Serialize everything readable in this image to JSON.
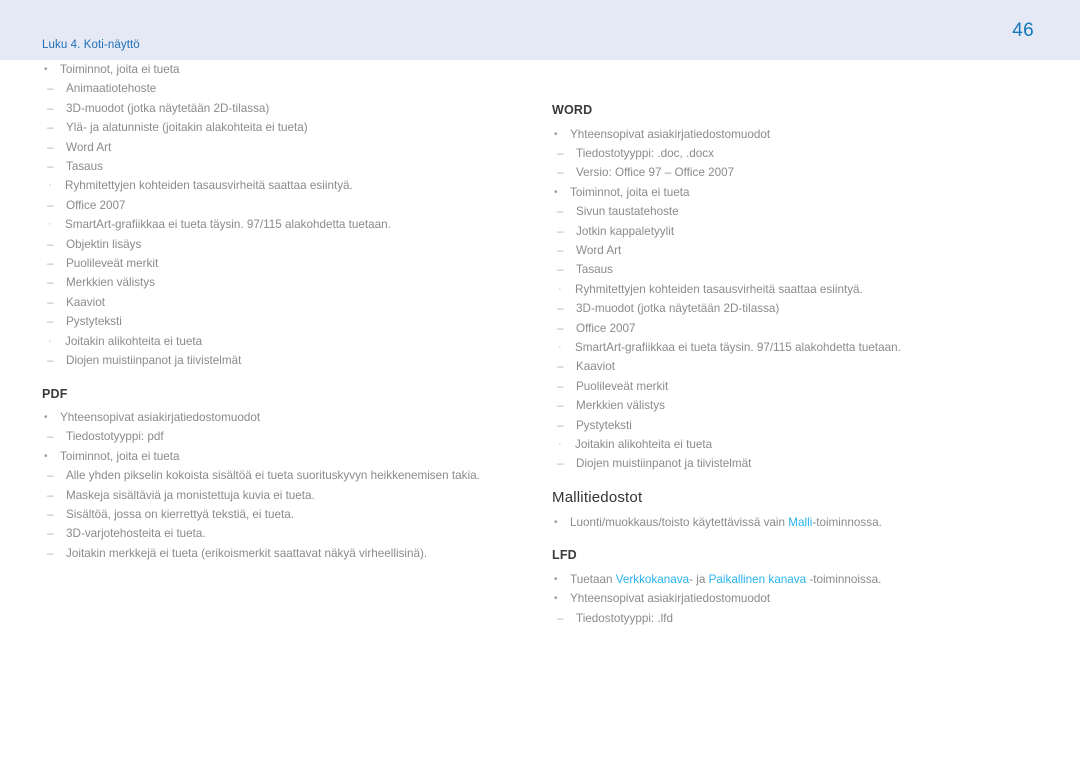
{
  "header": {
    "chapter": "Luku 4. Koti-näyttö",
    "page_number": "46",
    "band_color": "#e4e9f5",
    "chapter_color": "#1f6fb5",
    "page_number_color": "#1478bd"
  },
  "theme": {
    "body_text_color": "#8b8b8b",
    "heading_color": "#3a3a3a",
    "highlight_color": "#29b3ee",
    "background": "#ffffff"
  },
  "markers": {
    "level1": "•",
    "level2": "–",
    "level3": "·"
  },
  "left_column": {
    "intro_list": {
      "item": "Toiminnot, joita ei tueta",
      "subitems": [
        {
          "text": "Animaatiotehoste"
        },
        {
          "text": "3D-muodot (jotka näytetään 2D-tilassa)"
        },
        {
          "text": "Ylä- ja alatunniste (joitakin alakohteita ei tueta)"
        },
        {
          "text": "Word Art"
        },
        {
          "text": "Tasaus",
          "sub": [
            "Ryhmitettyjen kohteiden tasausvirheitä saattaa esiintyä."
          ]
        },
        {
          "text": "Office 2007",
          "sub": [
            "SmartArt-grafiikkaa ei tueta täysin. 97/115 alakohdetta tuetaan."
          ]
        },
        {
          "text": "Objektin lisäys"
        },
        {
          "text": "Puolileveät merkit"
        },
        {
          "text": "Merkkien välistys"
        },
        {
          "text": "Kaaviot"
        },
        {
          "text": "Pystyteksti",
          "sub": [
            "Joitakin alikohteita ei tueta"
          ]
        },
        {
          "text": "Diojen muistiinpanot ja tiivistelmät"
        }
      ]
    },
    "pdf_section": {
      "heading": "PDF",
      "items": [
        {
          "text": "Yhteensopivat asiakirjatiedostomuodot",
          "subitems": [
            {
              "text": "Tiedostotyyppi: pdf"
            }
          ]
        },
        {
          "text": "Toiminnot, joita ei tueta",
          "subitems": [
            {
              "text": "Alle yhden pikselin kokoista sisältöä ei tueta suorituskyvyn heikkenemisen takia."
            },
            {
              "text": "Maskeja sisältäviä ja monistettuja kuvia ei tueta."
            },
            {
              "text": "Sisältöä, jossa on kierrettyä tekstiä, ei tueta."
            },
            {
              "text": "3D-varjotehosteita ei tueta."
            },
            {
              "text": "Joitakin merkkejä ei tueta (erikoismerkit saattavat näkyä virheellisinä)."
            }
          ]
        }
      ]
    }
  },
  "right_column": {
    "word_section": {
      "heading": "WORD",
      "items": [
        {
          "text": "Yhteensopivat asiakirjatiedostomuodot",
          "subitems": [
            {
              "text": "Tiedostotyyppi: .doc, .docx"
            },
            {
              "text": "Versio: Office 97 – Office 2007"
            }
          ]
        },
        {
          "text": "Toiminnot, joita ei tueta",
          "subitems": [
            {
              "text": "Sivun taustatehoste"
            },
            {
              "text": "Jotkin kappaletyylit"
            },
            {
              "text": "Word Art"
            },
            {
              "text": "Tasaus",
              "sub": [
                "Ryhmitettyjen kohteiden tasausvirheitä saattaa esiintyä."
              ]
            },
            {
              "text": "3D-muodot (jotka näytetään 2D-tilassa)"
            },
            {
              "text": "Office 2007",
              "sub": [
                "SmartArt-grafiikkaa ei tueta täysin. 97/115 alakohdetta tuetaan."
              ]
            },
            {
              "text": "Kaaviot"
            },
            {
              "text": "Puolileveät merkit"
            },
            {
              "text": "Merkkien välistys"
            },
            {
              "text": "Pystyteksti",
              "sub": [
                "Joitakin alikohteita ei tueta"
              ]
            },
            {
              "text": "Diojen muistiinpanot ja tiivistelmät"
            }
          ]
        }
      ]
    },
    "template_section": {
      "heading": "Mallitiedostot",
      "bullet_prefix": "Luonti/muokkaus/toisto käytettävissä vain ",
      "bullet_highlight": "Malli",
      "bullet_suffix": "-toiminnossa."
    },
    "lfd_section": {
      "heading": "LFD",
      "bullet1_prefix": "Tuetaan ",
      "bullet1_highlight1": "Verkkokanava",
      "bullet1_mid": "- ja ",
      "bullet1_highlight2": "Paikallinen kanava",
      "bullet1_suffix": " -toiminnoissa.",
      "bullet2": "Yhteensopivat asiakirjatiedostomuodot",
      "bullet2_sub": "Tiedostotyyppi: .lfd"
    }
  }
}
